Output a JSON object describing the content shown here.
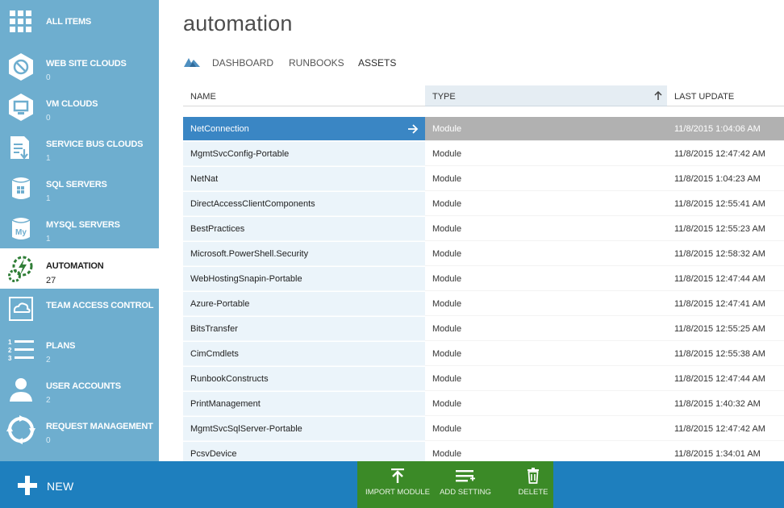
{
  "sidebar": {
    "items": [
      {
        "label": "ALL ITEMS",
        "count": "",
        "icon": "grid-icon"
      },
      {
        "label": "WEB SITE CLOUDS",
        "count": "0",
        "icon": "web-site-clouds-icon"
      },
      {
        "label": "VM CLOUDS",
        "count": "0",
        "icon": "vm-clouds-icon"
      },
      {
        "label": "SERVICE BUS CLOUDS",
        "count": "1",
        "icon": "service-bus-icon"
      },
      {
        "label": "SQL SERVERS",
        "count": "1",
        "icon": "sql-server-icon"
      },
      {
        "label": "MYSQL SERVERS",
        "count": "1",
        "icon": "mysql-icon"
      },
      {
        "label": "AUTOMATION",
        "count": "27",
        "icon": "automation-icon"
      },
      {
        "label": "TEAM ACCESS CONTROL",
        "count": "",
        "icon": "team-access-icon"
      },
      {
        "label": "PLANS",
        "count": "2",
        "icon": "plans-icon"
      },
      {
        "label": "USER ACCOUNTS",
        "count": "2",
        "icon": "user-icon"
      },
      {
        "label": "REQUEST MANAGEMENT",
        "count": "0",
        "icon": "request-management-icon"
      }
    ],
    "active": "AUTOMATION"
  },
  "main": {
    "title": "automation",
    "tabs": [
      {
        "label": "DASHBOARD"
      },
      {
        "label": "RUNBOOKS"
      },
      {
        "label": "ASSETS"
      }
    ],
    "active_tab": "ASSETS"
  },
  "table": {
    "columns": {
      "name": "NAME",
      "type": "TYPE",
      "last_update": "LAST UPDATE"
    },
    "sorted_by": "TYPE",
    "rows": [
      {
        "name": "NetConnection",
        "type": "Module",
        "last_update": "11/8/2015 1:04:06 AM"
      },
      {
        "name": "MgmtSvcConfig-Portable",
        "type": "Module",
        "last_update": "11/8/2015 12:47:42 AM"
      },
      {
        "name": "NetNat",
        "type": "Module",
        "last_update": "11/8/2015 1:04:23 AM"
      },
      {
        "name": "DirectAccessClientComponents",
        "type": "Module",
        "last_update": "11/8/2015 12:55:41 AM"
      },
      {
        "name": "BestPractices",
        "type": "Module",
        "last_update": "11/8/2015 12:55:23 AM"
      },
      {
        "name": "Microsoft.PowerShell.Security",
        "type": "Module",
        "last_update": "11/8/2015 12:58:32 AM"
      },
      {
        "name": "WebHostingSnapin-Portable",
        "type": "Module",
        "last_update": "11/8/2015 12:47:44 AM"
      },
      {
        "name": "Azure-Portable",
        "type": "Module",
        "last_update": "11/8/2015 12:47:41 AM"
      },
      {
        "name": "BitsTransfer",
        "type": "Module",
        "last_update": "11/8/2015 12:55:25 AM"
      },
      {
        "name": "CimCmdlets",
        "type": "Module",
        "last_update": "11/8/2015 12:55:38 AM"
      },
      {
        "name": "RunbookConstructs",
        "type": "Module",
        "last_update": "11/8/2015 12:47:44 AM"
      },
      {
        "name": "PrintManagement",
        "type": "Module",
        "last_update": "11/8/2015 1:40:32 AM"
      },
      {
        "name": "MgmtSvcSqlServer-Portable",
        "type": "Module",
        "last_update": "11/8/2015 12:47:42 AM"
      },
      {
        "name": "PcsvDevice",
        "type": "Module",
        "last_update": "11/8/2015 1:34:01 AM"
      }
    ],
    "selected_row": "NetConnection"
  },
  "command_bar": {
    "new_label": "NEW",
    "actions": [
      {
        "label": "IMPORT MODULE",
        "icon": "upload-icon"
      },
      {
        "label": "ADD SETTING",
        "icon": "add-setting-icon"
      },
      {
        "label": "DELETE",
        "icon": "trash-icon"
      }
    ]
  },
  "colors": {
    "sidebar_bg": "#6eaecf",
    "selected_name": "#3a86c4",
    "selected_row": "#b1b1b1",
    "command_bar": "#1e7fbe",
    "action_group": "#3b8a27"
  }
}
